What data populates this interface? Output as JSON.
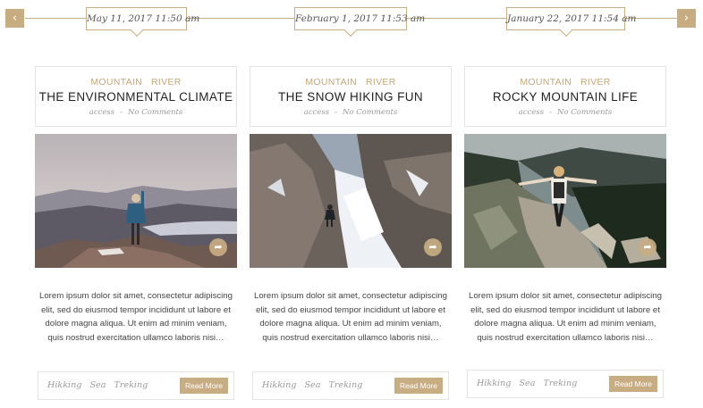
{
  "timeline": {
    "prev_icon": "chevron-left-icon",
    "next_icon": "chevron-right-icon",
    "prev_glyph": "‹",
    "next_glyph": "›",
    "dates": [
      "May 11, 2017 11:50 am",
      "February 1, 2017 11:53 am",
      "January 22, 2017 11:54 am"
    ]
  },
  "theme": {
    "accent": "#c8ad83",
    "text": "#222222",
    "muted": "#999999",
    "border": "#e3e3e3"
  },
  "posts": [
    {
      "categories": [
        "MOUNTAIN",
        "RIVER"
      ],
      "title": "THE ENVIRONMENTAL CLIMATE",
      "author": "access",
      "separator": "-",
      "comments": "No Comments",
      "image_icon": "hiker-on-mountain-photo",
      "share_icon": "share-icon",
      "share_glyph": "➦",
      "excerpt": "Lorem ipsum dolor sit amet, consectetur adipiscing elit, sed do eiusmod tempor incididunt ut labore et dolore magna aliqua. Ut enim ad minim veniam, quis nostrud exercitation ullamco laboris nisi…",
      "tags": [
        "Hikking",
        "Sea",
        "Treking"
      ],
      "read_more": "Read More"
    },
    {
      "categories": [
        "MOUNTAIN",
        "RIVER"
      ],
      "title": "THE SNOW HIKING FUN",
      "author": "access",
      "separator": "-",
      "comments": "No Comments",
      "image_icon": "snow-canyon-photo",
      "share_icon": "share-icon",
      "share_glyph": "➦",
      "excerpt": "Lorem ipsum dolor sit amet, consectetur adipiscing elit, sed do eiusmod tempor incididunt ut labore et dolore magna aliqua. Ut enim ad minim veniam, quis nostrud exercitation ullamco laboris nisi…",
      "tags": [
        "Hikking",
        "Sea",
        "Treking"
      ],
      "read_more": "Read More"
    },
    {
      "categories": [
        "MOUNTAIN",
        "RIVER"
      ],
      "title": "ROCKY MOUNTAIN LIFE",
      "author": "access",
      "separator": "-",
      "comments": "No Comments",
      "image_icon": "rocky-trail-photo",
      "share_icon": "share-icon",
      "share_glyph": "➦",
      "excerpt": "Lorem ipsum dolor sit amet, consectetur adipiscing elit, sed do eiusmod tempor incididunt ut labore et dolore magna aliqua. Ut enim ad minim veniam, quis nostrud exercitation ullamco laboris nisi…",
      "tags": [
        "Hikking",
        "Sea",
        "Treking"
      ],
      "read_more": "Read More"
    }
  ]
}
